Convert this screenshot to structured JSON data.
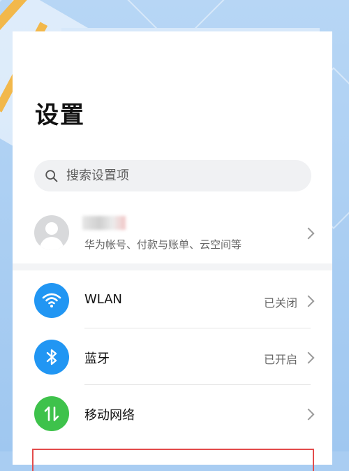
{
  "page": {
    "title": "设置"
  },
  "search": {
    "placeholder": "搜索设置项"
  },
  "account": {
    "name": "",
    "subtitle": "华为帐号、付款与账单、云空间等"
  },
  "settings_items": [
    {
      "label": "WLAN",
      "status": "已关闭",
      "icon": "wifi-icon",
      "color": "#2196f3"
    },
    {
      "label": "蓝牙",
      "status": "已开启",
      "icon": "bluetooth-icon",
      "color": "#2196f3"
    },
    {
      "label": "移动网络",
      "status": "",
      "icon": "mobile-data-icon",
      "color": "#3ec24b"
    }
  ],
  "colors": {
    "accent_red": "#e34c4c"
  }
}
